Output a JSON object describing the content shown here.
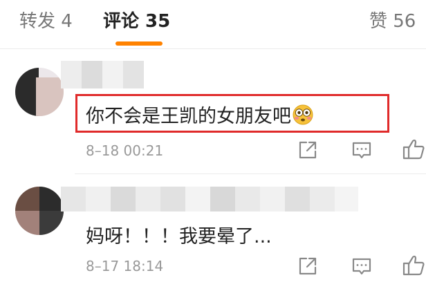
{
  "tabs": {
    "repost": "转发 4",
    "comments": "评论 35",
    "likes": "赞 56"
  },
  "colors": {
    "accent": "#ff8200",
    "highlight": "#e02a2a"
  },
  "comments": [
    {
      "text": "你不会是王凯的女朋友吧",
      "emoji": "flushed-face-emoji",
      "time": "8–18 00:21"
    },
    {
      "text": "妈呀！！！我要晕了...",
      "time": "8–17 18:14"
    }
  ],
  "icons": [
    "share-icon",
    "comment-icon",
    "thumbs-up-icon"
  ]
}
